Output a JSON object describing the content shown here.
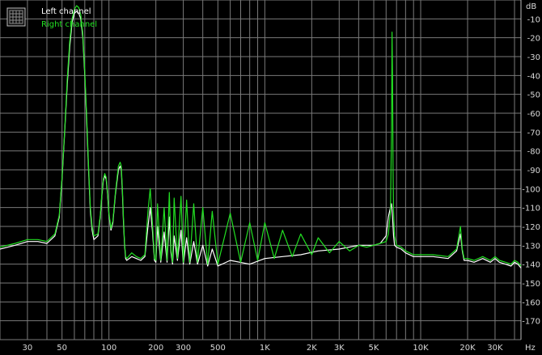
{
  "chart_data": {
    "type": "line",
    "title": "",
    "xlabel": "",
    "ylabel": "",
    "x_unit": "Hz",
    "y_unit": "dB",
    "x_scale": "log",
    "xlim": [
      20,
      44000
    ],
    "ylim": [
      -180,
      0
    ],
    "grid": true,
    "legend_position": "top-left",
    "x_ticks": [
      {
        "value": 30,
        "label": "30"
      },
      {
        "value": 50,
        "label": "50"
      },
      {
        "value": 100,
        "label": "100"
      },
      {
        "value": 200,
        "label": "200"
      },
      {
        "value": 300,
        "label": "300"
      },
      {
        "value": 500,
        "label": "500"
      },
      {
        "value": 1000,
        "label": "1K"
      },
      {
        "value": 2000,
        "label": "2K"
      },
      {
        "value": 3000,
        "label": "3K"
      },
      {
        "value": 5000,
        "label": "5K"
      },
      {
        "value": 10000,
        "label": "10K"
      },
      {
        "value": 20000,
        "label": "20K"
      },
      {
        "value": 30000,
        "label": "30K"
      }
    ],
    "y_ticks": [
      {
        "value": -10,
        "label": "-10"
      },
      {
        "value": -20,
        "label": "-20"
      },
      {
        "value": -30,
        "label": "-30"
      },
      {
        "value": -40,
        "label": "-40"
      },
      {
        "value": -50,
        "label": "-50"
      },
      {
        "value": -60,
        "label": "-60"
      },
      {
        "value": -70,
        "label": "-70"
      },
      {
        "value": -80,
        "label": "-80"
      },
      {
        "value": -90,
        "label": "-90"
      },
      {
        "value": -100,
        "label": "-100"
      },
      {
        "value": -110,
        "label": "-110"
      },
      {
        "value": -120,
        "label": "-120"
      },
      {
        "value": -130,
        "label": "-130"
      },
      {
        "value": -140,
        "label": "-140"
      },
      {
        "value": -150,
        "label": "-150"
      },
      {
        "value": -160,
        "label": "-160"
      },
      {
        "value": -170,
        "label": "-170"
      }
    ],
    "series": [
      {
        "name": "Left channel",
        "color": "#ffffff",
        "x": [
          20,
          25,
          30,
          35,
          40,
          45,
          48,
          50,
          52,
          54,
          56,
          58,
          60,
          62,
          64,
          66,
          68,
          70,
          72,
          74,
          76,
          78,
          80,
          85,
          88,
          90,
          92,
          94,
          96,
          98,
          100,
          103,
          106,
          110,
          115,
          118,
          120,
          122,
          124,
          126,
          128,
          130,
          140,
          150,
          160,
          170,
          178,
          184,
          190,
          196,
          200,
          205,
          215,
          226,
          236,
          244,
          250,
          256,
          262,
          275,
          290,
          300,
          315,
          330,
          350,
          370,
          400,
          430,
          460,
          500,
          600,
          800,
          1000,
          1300,
          1700,
          2200,
          3000,
          4000,
          5000,
          5500,
          6000,
          6200,
          6400,
          6500,
          6600,
          6700,
          6800,
          7000,
          7500,
          8000,
          9000,
          10000,
          12000,
          15000,
          17000,
          18000,
          18500,
          19000,
          20000,
          22000,
          25000,
          28000,
          30000,
          32000,
          35000,
          38000,
          40000,
          42000,
          44000
        ],
        "y": [
          -132,
          -130,
          -128,
          -128,
          -129,
          -125,
          -115,
          -95,
          -70,
          -45,
          -25,
          -12,
          -7,
          -6,
          -7,
          -10,
          -20,
          -40,
          -65,
          -90,
          -112,
          -122,
          -127,
          -125,
          -115,
          -104,
          -96,
          -93,
          -95,
          -103,
          -114,
          -122,
          -118,
          -103,
          -90,
          -88,
          -90,
          -102,
          -118,
          -130,
          -137,
          -138,
          -136,
          -137,
          -138,
          -136,
          -120,
          -110,
          -122,
          -138,
          -139,
          -120,
          -139,
          -123,
          -139,
          -115,
          -134,
          -140,
          -125,
          -138,
          -122,
          -140,
          -126,
          -140,
          -128,
          -140,
          -130,
          -141,
          -132,
          -141,
          -138,
          -140,
          -137,
          -136,
          -135,
          -133,
          -132,
          -130,
          -130,
          -129,
          -125,
          -115,
          -110,
          -108,
          -115,
          -125,
          -130,
          -131,
          -132,
          -134,
          -136,
          -136,
          -136,
          -137,
          -133,
          -124,
          -133,
          -138,
          -138,
          -139,
          -137,
          -139,
          -137,
          -139,
          -140,
          -141,
          -139,
          -140,
          -142
        ]
      },
      {
        "name": "Right channel",
        "color": "#22e022",
        "x": [
          20,
          25,
          30,
          35,
          40,
          45,
          48,
          50,
          52,
          54,
          56,
          58,
          60,
          62,
          64,
          66,
          68,
          70,
          72,
          74,
          76,
          78,
          80,
          85,
          88,
          90,
          92,
          94,
          96,
          98,
          100,
          103,
          106,
          110,
          115,
          118,
          120,
          122,
          124,
          126,
          128,
          130,
          140,
          150,
          160,
          170,
          178,
          184,
          190,
          196,
          200,
          205,
          215,
          226,
          236,
          244,
          250,
          256,
          262,
          275,
          290,
          300,
          315,
          330,
          350,
          370,
          400,
          430,
          460,
          500,
          600,
          700,
          800,
          900,
          1000,
          1150,
          1300,
          1500,
          1700,
          2000,
          2200,
          2600,
          3000,
          3500,
          4000,
          4500,
          5000,
          5500,
          6000,
          6200,
          6400,
          6500,
          6550,
          6600,
          6650,
          6700,
          6800,
          7000,
          7500,
          8000,
          9000,
          10000,
          12000,
          15000,
          17000,
          18000,
          18500,
          19000,
          20000,
          22000,
          25000,
          28000,
          30000,
          32000,
          35000,
          38000,
          40000,
          42000,
          44000
        ],
        "y": [
          -131,
          -129,
          -127,
          -127,
          -128,
          -124,
          -114,
          -94,
          -69,
          -42,
          -22,
          -10,
          -5,
          -3,
          -4,
          -8,
          -18,
          -38,
          -62,
          -88,
          -110,
          -120,
          -125,
          -124,
          -114,
          -103,
          -95,
          -92,
          -94,
          -102,
          -113,
          -121,
          -117,
          -102,
          -88,
          -86,
          -88,
          -100,
          -116,
          -129,
          -136,
          -137,
          -134,
          -136,
          -137,
          -135,
          -112,
          -100,
          -118,
          -137,
          -138,
          -108,
          -138,
          -110,
          -138,
          -102,
          -132,
          -139,
          -105,
          -137,
          -104,
          -139,
          -106,
          -139,
          -108,
          -139,
          -110,
          -140,
          -112,
          -140,
          -113,
          -139,
          -118,
          -138,
          -118,
          -137,
          -122,
          -136,
          -124,
          -135,
          -126,
          -134,
          -128,
          -133,
          -130,
          -131,
          -130,
          -129,
          -128,
          -124,
          -112,
          -70,
          -17,
          -40,
          -90,
          -112,
          -125,
          -130,
          -131,
          -133,
          -135,
          -135,
          -135,
          -136,
          -132,
          -120,
          -132,
          -137,
          -137,
          -138,
          -136,
          -138,
          -136,
          -138,
          -139,
          -140,
          -138,
          -139,
          -141
        ]
      }
    ]
  }
}
